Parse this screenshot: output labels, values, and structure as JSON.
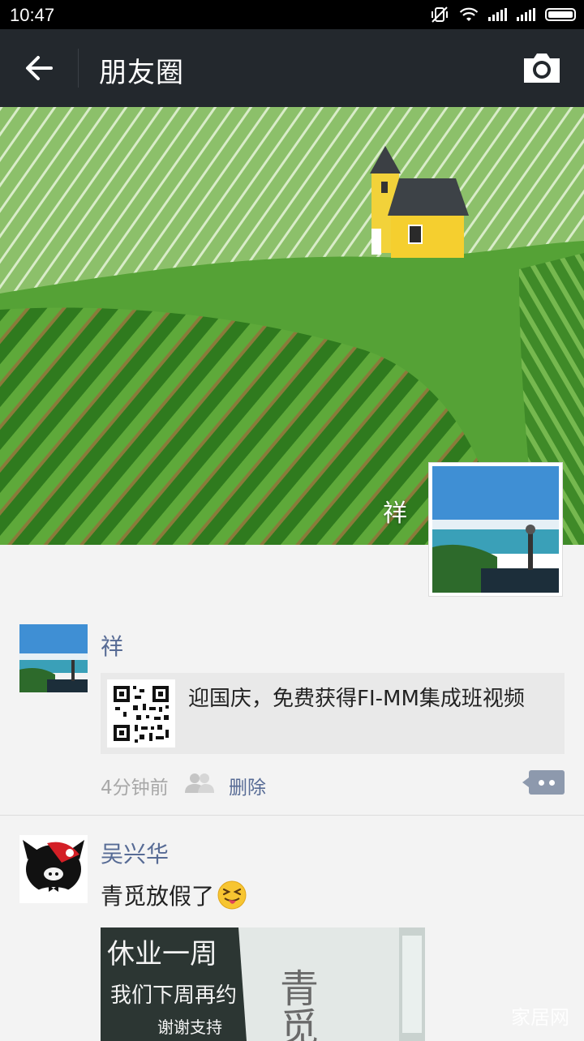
{
  "status_bar": {
    "time": "10:47"
  },
  "header": {
    "title": "朋友圈"
  },
  "cover": {
    "user_name": "祥"
  },
  "posts": [
    {
      "user_name": "祥",
      "link_title": "迎国庆，免费获得FI-MM集成班视频",
      "time": "4分钟前",
      "delete_label": "删除"
    },
    {
      "user_name": "吴兴华",
      "text": "青觅放假了"
    }
  ],
  "photo_text": {
    "board_line1": "休业一周",
    "board_line2": "我们下周再约",
    "board_line3": "谢谢支持",
    "wall_text": "青觅"
  },
  "watermark": "家居网",
  "colors": {
    "header_bg": "#23282d",
    "link_name": "#576b95",
    "page_bg": "#f3f3f3"
  }
}
